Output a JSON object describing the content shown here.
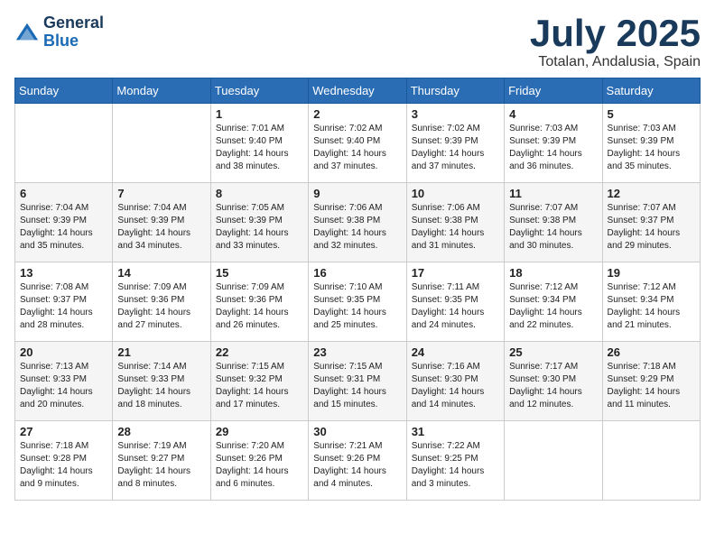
{
  "logo": {
    "line1": "General",
    "line2": "Blue"
  },
  "title": "July 2025",
  "location": "Totalan, Andalusia, Spain",
  "weekdays": [
    "Sunday",
    "Monday",
    "Tuesday",
    "Wednesday",
    "Thursday",
    "Friday",
    "Saturday"
  ],
  "weeks": [
    [
      {
        "day": "",
        "sunrise": "",
        "sunset": "",
        "daylight": ""
      },
      {
        "day": "",
        "sunrise": "",
        "sunset": "",
        "daylight": ""
      },
      {
        "day": "1",
        "sunrise": "Sunrise: 7:01 AM",
        "sunset": "Sunset: 9:40 PM",
        "daylight": "Daylight: 14 hours and 38 minutes."
      },
      {
        "day": "2",
        "sunrise": "Sunrise: 7:02 AM",
        "sunset": "Sunset: 9:40 PM",
        "daylight": "Daylight: 14 hours and 37 minutes."
      },
      {
        "day": "3",
        "sunrise": "Sunrise: 7:02 AM",
        "sunset": "Sunset: 9:39 PM",
        "daylight": "Daylight: 14 hours and 37 minutes."
      },
      {
        "day": "4",
        "sunrise": "Sunrise: 7:03 AM",
        "sunset": "Sunset: 9:39 PM",
        "daylight": "Daylight: 14 hours and 36 minutes."
      },
      {
        "day": "5",
        "sunrise": "Sunrise: 7:03 AM",
        "sunset": "Sunset: 9:39 PM",
        "daylight": "Daylight: 14 hours and 35 minutes."
      }
    ],
    [
      {
        "day": "6",
        "sunrise": "Sunrise: 7:04 AM",
        "sunset": "Sunset: 9:39 PM",
        "daylight": "Daylight: 14 hours and 35 minutes."
      },
      {
        "day": "7",
        "sunrise": "Sunrise: 7:04 AM",
        "sunset": "Sunset: 9:39 PM",
        "daylight": "Daylight: 14 hours and 34 minutes."
      },
      {
        "day": "8",
        "sunrise": "Sunrise: 7:05 AM",
        "sunset": "Sunset: 9:39 PM",
        "daylight": "Daylight: 14 hours and 33 minutes."
      },
      {
        "day": "9",
        "sunrise": "Sunrise: 7:06 AM",
        "sunset": "Sunset: 9:38 PM",
        "daylight": "Daylight: 14 hours and 32 minutes."
      },
      {
        "day": "10",
        "sunrise": "Sunrise: 7:06 AM",
        "sunset": "Sunset: 9:38 PM",
        "daylight": "Daylight: 14 hours and 31 minutes."
      },
      {
        "day": "11",
        "sunrise": "Sunrise: 7:07 AM",
        "sunset": "Sunset: 9:38 PM",
        "daylight": "Daylight: 14 hours and 30 minutes."
      },
      {
        "day": "12",
        "sunrise": "Sunrise: 7:07 AM",
        "sunset": "Sunset: 9:37 PM",
        "daylight": "Daylight: 14 hours and 29 minutes."
      }
    ],
    [
      {
        "day": "13",
        "sunrise": "Sunrise: 7:08 AM",
        "sunset": "Sunset: 9:37 PM",
        "daylight": "Daylight: 14 hours and 28 minutes."
      },
      {
        "day": "14",
        "sunrise": "Sunrise: 7:09 AM",
        "sunset": "Sunset: 9:36 PM",
        "daylight": "Daylight: 14 hours and 27 minutes."
      },
      {
        "day": "15",
        "sunrise": "Sunrise: 7:09 AM",
        "sunset": "Sunset: 9:36 PM",
        "daylight": "Daylight: 14 hours and 26 minutes."
      },
      {
        "day": "16",
        "sunrise": "Sunrise: 7:10 AM",
        "sunset": "Sunset: 9:35 PM",
        "daylight": "Daylight: 14 hours and 25 minutes."
      },
      {
        "day": "17",
        "sunrise": "Sunrise: 7:11 AM",
        "sunset": "Sunset: 9:35 PM",
        "daylight": "Daylight: 14 hours and 24 minutes."
      },
      {
        "day": "18",
        "sunrise": "Sunrise: 7:12 AM",
        "sunset": "Sunset: 9:34 PM",
        "daylight": "Daylight: 14 hours and 22 minutes."
      },
      {
        "day": "19",
        "sunrise": "Sunrise: 7:12 AM",
        "sunset": "Sunset: 9:34 PM",
        "daylight": "Daylight: 14 hours and 21 minutes."
      }
    ],
    [
      {
        "day": "20",
        "sunrise": "Sunrise: 7:13 AM",
        "sunset": "Sunset: 9:33 PM",
        "daylight": "Daylight: 14 hours and 20 minutes."
      },
      {
        "day": "21",
        "sunrise": "Sunrise: 7:14 AM",
        "sunset": "Sunset: 9:33 PM",
        "daylight": "Daylight: 14 hours and 18 minutes."
      },
      {
        "day": "22",
        "sunrise": "Sunrise: 7:15 AM",
        "sunset": "Sunset: 9:32 PM",
        "daylight": "Daylight: 14 hours and 17 minutes."
      },
      {
        "day": "23",
        "sunrise": "Sunrise: 7:15 AM",
        "sunset": "Sunset: 9:31 PM",
        "daylight": "Daylight: 14 hours and 15 minutes."
      },
      {
        "day": "24",
        "sunrise": "Sunrise: 7:16 AM",
        "sunset": "Sunset: 9:30 PM",
        "daylight": "Daylight: 14 hours and 14 minutes."
      },
      {
        "day": "25",
        "sunrise": "Sunrise: 7:17 AM",
        "sunset": "Sunset: 9:30 PM",
        "daylight": "Daylight: 14 hours and 12 minutes."
      },
      {
        "day": "26",
        "sunrise": "Sunrise: 7:18 AM",
        "sunset": "Sunset: 9:29 PM",
        "daylight": "Daylight: 14 hours and 11 minutes."
      }
    ],
    [
      {
        "day": "27",
        "sunrise": "Sunrise: 7:18 AM",
        "sunset": "Sunset: 9:28 PM",
        "daylight": "Daylight: 14 hours and 9 minutes."
      },
      {
        "day": "28",
        "sunrise": "Sunrise: 7:19 AM",
        "sunset": "Sunset: 9:27 PM",
        "daylight": "Daylight: 14 hours and 8 minutes."
      },
      {
        "day": "29",
        "sunrise": "Sunrise: 7:20 AM",
        "sunset": "Sunset: 9:26 PM",
        "daylight": "Daylight: 14 hours and 6 minutes."
      },
      {
        "day": "30",
        "sunrise": "Sunrise: 7:21 AM",
        "sunset": "Sunset: 9:26 PM",
        "daylight": "Daylight: 14 hours and 4 minutes."
      },
      {
        "day": "31",
        "sunrise": "Sunrise: 7:22 AM",
        "sunset": "Sunset: 9:25 PM",
        "daylight": "Daylight: 14 hours and 3 minutes."
      },
      {
        "day": "",
        "sunrise": "",
        "sunset": "",
        "daylight": ""
      },
      {
        "day": "",
        "sunrise": "",
        "sunset": "",
        "daylight": ""
      }
    ]
  ]
}
